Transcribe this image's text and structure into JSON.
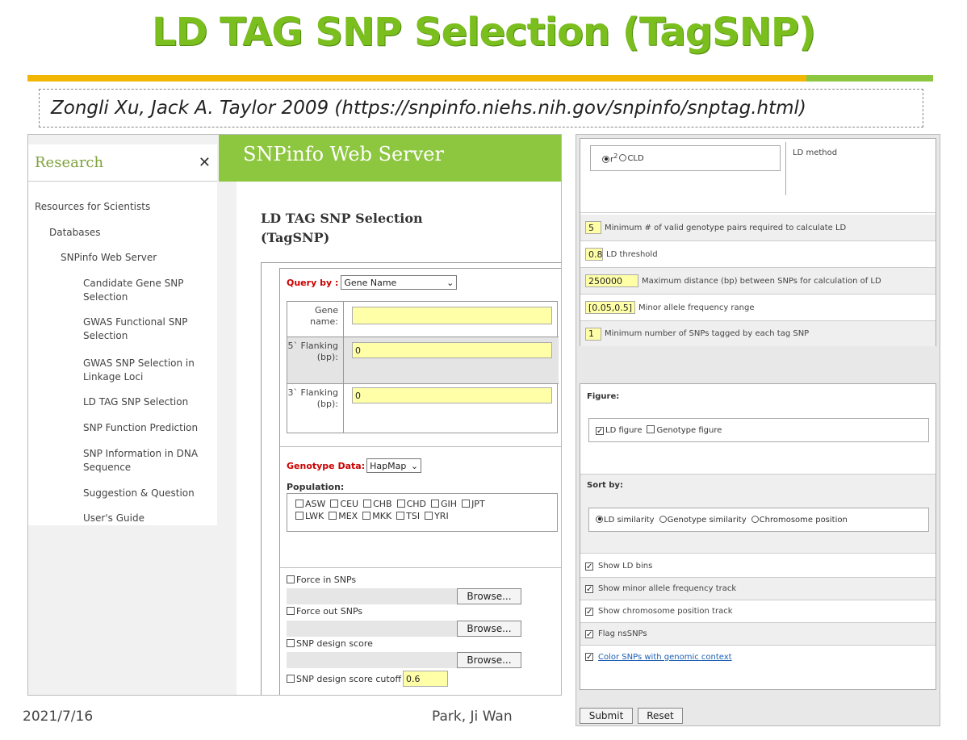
{
  "slide": {
    "title": "LD TAG SNP Selection (TagSNP)",
    "citation": "Zongli Xu, Jack A. Taylor 2009  (https://snpinfo.niehs.nih.gov/snpinfo/snptag.html)",
    "date": "2021/7/16",
    "author": "Park, Ji Wan",
    "title_color": "#7bbf1e",
    "bar_colors": [
      "#f2b705",
      "#8dc63f"
    ]
  },
  "sidebar": {
    "title": "Research",
    "close_icon": "close-icon",
    "items": [
      "Resources for Scientists",
      "Databases",
      "SNPinfo Web Server",
      "Candidate Gene SNP Selection",
      "GWAS Functional SNP Selection",
      "GWAS SNP Selection in Linkage Loci",
      "LD TAG SNP Selection",
      "SNP Function Prediction",
      "SNP Information in DNA Sequence",
      "Suggestion & Question",
      "User's Guide"
    ]
  },
  "server": {
    "name": "SNPinfo Web Server",
    "accent": "#8dc63f"
  },
  "form": {
    "heading": "LD TAG SNP Selection (TagSNP)",
    "query_by_label": "Query by :",
    "query_by_value": "Gene Name",
    "gene_name_label": "Gene name:",
    "gene_name_value": "",
    "flank5_label": "5` Flanking (bp):",
    "flank5_value": "0",
    "flank3_label": "3` Flanking (bp):",
    "flank3_value": "0",
    "genotype_label": "Genotype Data:",
    "genotype_value": "HapMap",
    "population_label": "Population:",
    "populations_row1": [
      "ASW",
      "CEU",
      "CHB",
      "CHD",
      "GIH",
      "JPT"
    ],
    "populations_row2": [
      "LWK",
      "MEX",
      "MKK",
      "TSI",
      "YRI"
    ],
    "force_in": "Force in SNPs",
    "force_out": "Force out SNPs",
    "design_score": "SNP design score",
    "design_cutoff": "SNP design score cutoff",
    "design_cutoff_value": "0.6",
    "browse": "Browse..."
  },
  "ld": {
    "method_label": "LD method",
    "opt_r2": "r",
    "opt_r2_sup": "2",
    "opt_cld": "CLD",
    "params": [
      {
        "value": "5",
        "label": "Minimum # of valid genotype pairs required to calculate LD"
      },
      {
        "value": "0.8",
        "label": "LD threshold"
      },
      {
        "value": "250000",
        "label": "Maximum distance (bp) between SNPs for calculation of LD"
      },
      {
        "value": "[0.05,0.5]",
        "label": "Minor allele frequency range"
      },
      {
        "value": "1",
        "label": "Minimum number of SNPs tagged by each tag SNP"
      }
    ]
  },
  "figure": {
    "label": "Figure:",
    "ld_figure": "LD figure",
    "genotype_figure": "Genotype figure",
    "sort_label": "Sort by:",
    "sort_ld": "LD similarity",
    "sort_genotype": "Genotype similarity",
    "sort_chrom": "Chromosome position",
    "options": [
      "Show LD bins",
      "Show minor allele frequency track",
      "Show chromosome position track",
      "Flag nsSNPs",
      "Color SNPs with genomic context"
    ],
    "submit": "Submit",
    "reset": "Reset"
  }
}
